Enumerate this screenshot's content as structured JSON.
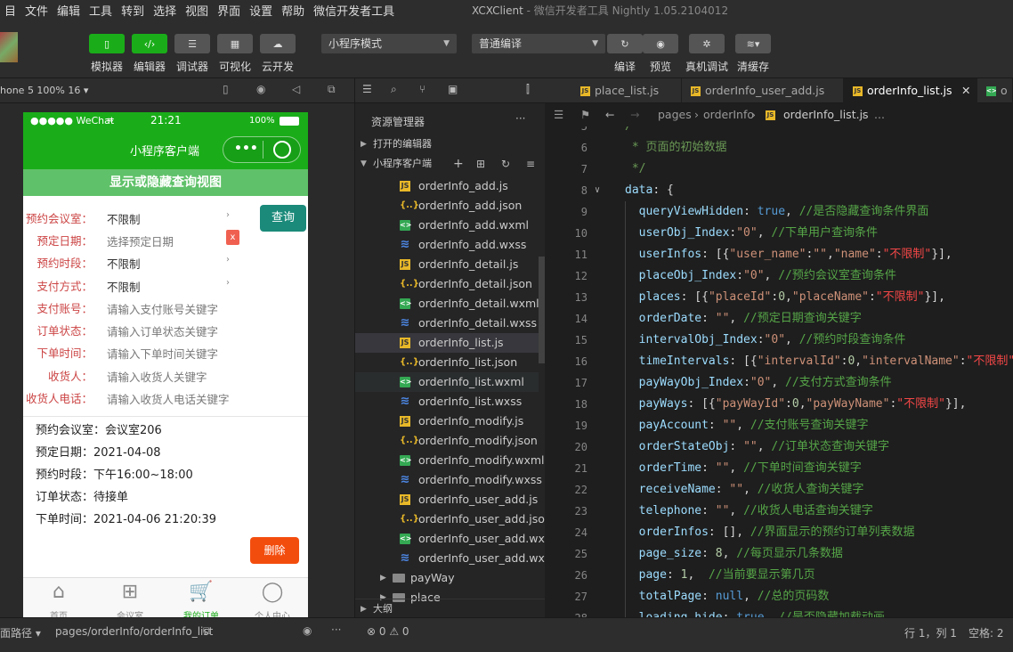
{
  "menu": [
    "目",
    "文件",
    "编辑",
    "工具",
    "转到",
    "选择",
    "视图",
    "界面",
    "设置",
    "帮助",
    "微信开发者工具"
  ],
  "window_title": "XCXClient",
  "window_subtitle": "- 微信开发者工具 Nightly 1.05.2104012",
  "toolbar": {
    "left_labels": [
      "模拟器",
      "编辑器",
      "调试器",
      "可视化",
      "云开发"
    ],
    "mode": "小程序模式",
    "compile_mode": "普通编译",
    "right_labels": [
      "编译",
      "预览",
      "真机调试",
      "清缓存"
    ]
  },
  "sim": {
    "device": "hone 5 100% 16 ▾",
    "status_carrier": "●●●●● WeChat",
    "status_time": "21:21",
    "status_battery": "100%",
    "nav_title": "小程序客户端",
    "toggle_label": "显示或隐藏查询视图",
    "filters": [
      {
        "label": "预约会议室：",
        "value": "不限制",
        "placeholder": false,
        "arrow": true
      },
      {
        "label": "预定日期：",
        "value": "选择预定日期",
        "placeholder": true,
        "arrow": false
      },
      {
        "label": "预约时段：",
        "value": "不限制",
        "placeholder": false,
        "arrow": true
      },
      {
        "label": "支付方式：",
        "value": "不限制",
        "placeholder": false,
        "arrow": true
      },
      {
        "label": "支付账号：",
        "value": "请输入支付账号关键字",
        "placeholder": true,
        "arrow": false
      },
      {
        "label": "订单状态：",
        "value": "请输入订单状态关键字",
        "placeholder": true,
        "arrow": false
      },
      {
        "label": "下单时间：",
        "value": "请输入下单时间关键字",
        "placeholder": true,
        "arrow": false
      },
      {
        "label": "收货人：",
        "value": "请输入收货人关键字",
        "placeholder": true,
        "arrow": false
      },
      {
        "label": "收货人电话：",
        "value": "请输入收货人电话关键字",
        "placeholder": true,
        "arrow": false
      }
    ],
    "query_label": "查询",
    "clear_label": "x",
    "order": [
      "预约会议室：会议室206",
      "预定日期：2021-04-08",
      "预约时段：下午16:00~18:00",
      "订单状态：待接单",
      "下单时间：2021-04-06 21:20:39"
    ],
    "delete_label": "删除",
    "tabs": [
      {
        "label": "首页",
        "icon": "home-icon"
      },
      {
        "label": "会议室",
        "icon": "grid-icon"
      },
      {
        "label": "我的订单",
        "icon": "cart-icon"
      },
      {
        "label": "个人中心",
        "icon": "user-icon"
      }
    ]
  },
  "explorer": {
    "title": "资源管理器",
    "open_editors": "打开的编辑器",
    "project": "小程序客户端",
    "outline": "大纲",
    "files": [
      {
        "name": "orderInfo_add.js",
        "type": "js"
      },
      {
        "name": "orderInfo_add.json",
        "type": "json"
      },
      {
        "name": "orderInfo_add.wxml",
        "type": "wxml"
      },
      {
        "name": "orderInfo_add.wxss",
        "type": "wxss"
      },
      {
        "name": "orderInfo_detail.js",
        "type": "js"
      },
      {
        "name": "orderInfo_detail.json",
        "type": "json"
      },
      {
        "name": "orderInfo_detail.wxml",
        "type": "wxml"
      },
      {
        "name": "orderInfo_detail.wxss",
        "type": "wxss"
      },
      {
        "name": "orderInfo_list.js",
        "type": "js"
      },
      {
        "name": "orderInfo_list.json",
        "type": "json"
      },
      {
        "name": "orderInfo_list.wxml",
        "type": "wxml"
      },
      {
        "name": "orderInfo_list.wxss",
        "type": "wxss"
      },
      {
        "name": "orderInfo_modify.js",
        "type": "js"
      },
      {
        "name": "orderInfo_modify.json",
        "type": "json"
      },
      {
        "name": "orderInfo_modify.wxml",
        "type": "wxml"
      },
      {
        "name": "orderInfo_modify.wxss",
        "type": "wxss"
      },
      {
        "name": "orderInfo_user_add.js",
        "type": "js"
      },
      {
        "name": "orderInfo_user_add.json",
        "type": "json"
      },
      {
        "name": "orderInfo_user_add.wx...",
        "type": "wxml"
      },
      {
        "name": "orderInfo_user_add.wxss",
        "type": "wxss"
      }
    ],
    "folders": [
      "payWay",
      "place"
    ]
  },
  "editor": {
    "tabs": [
      "place_list.js",
      "orderInfo_user_add.js",
      "orderInfo_list.js",
      "o"
    ],
    "breadcrumb": [
      "pages",
      "orderInfo",
      "orderInfo_list.js",
      "..."
    ],
    "lines": [
      {
        "n": "5",
        "fold": false,
        "parts": [
          [
            "cm",
            "/**"
          ]
        ]
      },
      {
        "n": "6",
        "fold": false,
        "parts": [
          [
            "cm",
            " * 页面的初始数据"
          ]
        ]
      },
      {
        "n": "7",
        "fold": false,
        "parts": [
          [
            "cm",
            " */"
          ]
        ]
      },
      {
        "n": "8",
        "fold": true,
        "parts": [
          [
            "k",
            "data"
          ],
          [
            "p",
            ": {"
          ]
        ]
      },
      {
        "n": "9",
        "fold": false,
        "parts": [
          [
            "k",
            "  queryViewHidden"
          ],
          [
            "p",
            ": "
          ],
          [
            "kw",
            "true"
          ],
          [
            "p",
            ", "
          ],
          [
            "cm2",
            "//是否隐藏查询条件界面"
          ]
        ]
      },
      {
        "n": "10",
        "fold": false,
        "parts": [
          [
            "k",
            "  userObj_Index"
          ],
          [
            "p",
            ":"
          ],
          [
            "s",
            "\"0\""
          ],
          [
            "p",
            ", "
          ],
          [
            "cm2",
            "//下单用户查询条件"
          ]
        ]
      },
      {
        "n": "11",
        "fold": false,
        "parts": [
          [
            "k",
            "  userInfos"
          ],
          [
            "p",
            ": [{"
          ],
          [
            "s",
            "\"user_name\""
          ],
          [
            "p",
            ":"
          ],
          [
            "s",
            "\"\""
          ],
          [
            "p",
            ","
          ],
          [
            "s",
            "\"name\""
          ],
          [
            "p",
            ":"
          ],
          [
            "r",
            "\"不限制\""
          ],
          [
            "p",
            "}],"
          ]
        ]
      },
      {
        "n": "12",
        "fold": false,
        "parts": [
          [
            "k",
            "  placeObj_Index"
          ],
          [
            "p",
            ":"
          ],
          [
            "s",
            "\"0\""
          ],
          [
            "p",
            ", "
          ],
          [
            "cm2",
            "//预约会议室查询条件"
          ]
        ]
      },
      {
        "n": "13",
        "fold": false,
        "parts": [
          [
            "k",
            "  places"
          ],
          [
            "p",
            ": [{"
          ],
          [
            "s",
            "\"placeId\""
          ],
          [
            "p",
            ":"
          ],
          [
            "n",
            "0"
          ],
          [
            "p",
            ","
          ],
          [
            "s",
            "\"placeName\""
          ],
          [
            "p",
            ":"
          ],
          [
            "r",
            "\"不限制\""
          ],
          [
            "p",
            "}],"
          ]
        ]
      },
      {
        "n": "14",
        "fold": false,
        "parts": [
          [
            "k",
            "  orderDate"
          ],
          [
            "p",
            ": "
          ],
          [
            "s",
            "\"\""
          ],
          [
            "p",
            ", "
          ],
          [
            "cm2",
            "//预定日期查询关键字"
          ]
        ]
      },
      {
        "n": "15",
        "fold": false,
        "parts": [
          [
            "k",
            "  intervalObj_Index"
          ],
          [
            "p",
            ":"
          ],
          [
            "s",
            "\"0\""
          ],
          [
            "p",
            ", "
          ],
          [
            "cm2",
            "//预约时段查询条件"
          ]
        ]
      },
      {
        "n": "16",
        "fold": false,
        "parts": [
          [
            "k",
            "  timeIntervals"
          ],
          [
            "p",
            ": [{"
          ],
          [
            "s",
            "\"intervalId\""
          ],
          [
            "p",
            ":"
          ],
          [
            "n",
            "0"
          ],
          [
            "p",
            ","
          ],
          [
            "s",
            "\"intervalName\""
          ],
          [
            "p",
            ":"
          ],
          [
            "r",
            "\"不限制\""
          ]
        ]
      },
      {
        "n": "17",
        "fold": false,
        "parts": [
          [
            "k",
            "  payWayObj_Index"
          ],
          [
            "p",
            ":"
          ],
          [
            "s",
            "\"0\""
          ],
          [
            "p",
            ", "
          ],
          [
            "cm2",
            "//支付方式查询条件"
          ]
        ]
      },
      {
        "n": "18",
        "fold": false,
        "parts": [
          [
            "k",
            "  payWays"
          ],
          [
            "p",
            ": [{"
          ],
          [
            "s",
            "\"payWayId\""
          ],
          [
            "p",
            ":"
          ],
          [
            "n",
            "0"
          ],
          [
            "p",
            ","
          ],
          [
            "s",
            "\"payWayName\""
          ],
          [
            "p",
            ":"
          ],
          [
            "r",
            "\"不限制\""
          ],
          [
            "p",
            "}],"
          ]
        ]
      },
      {
        "n": "19",
        "fold": false,
        "parts": [
          [
            "k",
            "  payAccount"
          ],
          [
            "p",
            ": "
          ],
          [
            "s",
            "\"\""
          ],
          [
            "p",
            ", "
          ],
          [
            "cm2",
            "//支付账号查询关键字"
          ]
        ]
      },
      {
        "n": "20",
        "fold": false,
        "parts": [
          [
            "k",
            "  orderStateObj"
          ],
          [
            "p",
            ": "
          ],
          [
            "s",
            "\"\""
          ],
          [
            "p",
            ", "
          ],
          [
            "cm2",
            "//订单状态查询关键字"
          ]
        ]
      },
      {
        "n": "21",
        "fold": false,
        "parts": [
          [
            "k",
            "  orderTime"
          ],
          [
            "p",
            ": "
          ],
          [
            "s",
            "\"\""
          ],
          [
            "p",
            ", "
          ],
          [
            "cm2",
            "//下单时间查询关键字"
          ]
        ]
      },
      {
        "n": "22",
        "fold": false,
        "parts": [
          [
            "k",
            "  receiveName"
          ],
          [
            "p",
            ": "
          ],
          [
            "s",
            "\"\""
          ],
          [
            "p",
            ", "
          ],
          [
            "cm2",
            "//收货人查询关键字"
          ]
        ]
      },
      {
        "n": "23",
        "fold": false,
        "parts": [
          [
            "k",
            "  telephone"
          ],
          [
            "p",
            ": "
          ],
          [
            "s",
            "\"\""
          ],
          [
            "p",
            ", "
          ],
          [
            "cm2",
            "//收货人电话查询关键字"
          ]
        ]
      },
      {
        "n": "24",
        "fold": false,
        "parts": [
          [
            "k",
            "  orderInfos"
          ],
          [
            "p",
            ": [], "
          ],
          [
            "cm2",
            "//界面显示的预约订单列表数据"
          ]
        ]
      },
      {
        "n": "25",
        "fold": false,
        "parts": [
          [
            "k",
            "  page_size"
          ],
          [
            "p",
            ": "
          ],
          [
            "n",
            "8"
          ],
          [
            "p",
            ", "
          ],
          [
            "cm2",
            "//每页显示几条数据"
          ]
        ]
      },
      {
        "n": "26",
        "fold": false,
        "parts": [
          [
            "k",
            "  page"
          ],
          [
            "p",
            ": "
          ],
          [
            "n",
            "1"
          ],
          [
            "p",
            ",  "
          ],
          [
            "cm2",
            "//当前要显示第几页"
          ]
        ]
      },
      {
        "n": "27",
        "fold": false,
        "parts": [
          [
            "k",
            "  totalPage"
          ],
          [
            "p",
            ": "
          ],
          [
            "kw",
            "null"
          ],
          [
            "p",
            ", "
          ],
          [
            "cm2",
            "//总的页码数"
          ]
        ]
      },
      {
        "n": "28",
        "fold": false,
        "parts": [
          [
            "k",
            "  loading_hide"
          ],
          [
            "p",
            ": "
          ],
          [
            "kw",
            "true"
          ],
          [
            "p",
            ", "
          ],
          [
            "cm2",
            "//是否隐藏加载动画"
          ]
        ]
      }
    ]
  },
  "statusbar": {
    "path_label": "面路径 ▾",
    "path": "pages/orderInfo/orderInfo_list",
    "problems": "⊗ 0 ⚠ 0",
    "position": "行 1，列 1",
    "spaces": "空格: 2"
  }
}
